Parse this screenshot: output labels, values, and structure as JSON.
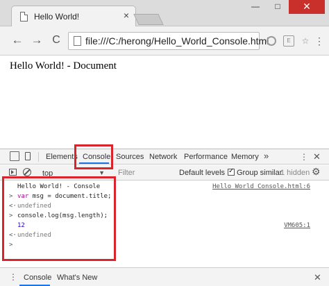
{
  "window": {
    "minimize_glyph": "—",
    "maximize_glyph": "□",
    "close_glyph": "✕"
  },
  "browser": {
    "tab_title": "Hello World!",
    "tab_close_glyph": "×",
    "back_glyph": "←",
    "forward_glyph": "→",
    "reload_glyph": "C",
    "url": "file:///C:/herong/Hello_World_Console.html",
    "ext2_label": "E",
    "ext3_glyph": "☆",
    "menu_glyph": "⋮"
  },
  "page": {
    "document_text": "Hello World! - Document"
  },
  "devtools": {
    "tabs": [
      "Elements",
      "Console",
      "Sources",
      "Network",
      "Performance",
      "Memory"
    ],
    "more_tabs_glyph": "»",
    "menu_glyph": "⋮",
    "close_glyph": "✕",
    "active_tab": "Console",
    "accent_color": "#1a73e8",
    "filterbar": {
      "context": "top",
      "context_arrow": "▼",
      "filter_placeholder": "Filter",
      "levels": "Default levels ▼",
      "group_similar": "Group similar",
      "group_similar_checked": true,
      "hidden_count": "1 hidden",
      "settings_glyph": "⚙"
    },
    "console": {
      "output_prefix": ">",
      "result_prefix": "<·",
      "prompt_glyph": ">",
      "log1": "Hello World! - Console",
      "log1_source": "Hello World Console.html:6",
      "input1_keyword": "var",
      "input1_rest": " msg = document.title;",
      "result1": "undefined",
      "input2": "console.log(msg.length);",
      "log2": "12",
      "log2_source": "VM605:1",
      "result2": "undefined"
    },
    "drawer": {
      "menu_glyph": "⋮",
      "tabs": [
        "Console",
        "What's New"
      ],
      "close_glyph": "✕"
    }
  },
  "highlight_color": "#d9242c"
}
